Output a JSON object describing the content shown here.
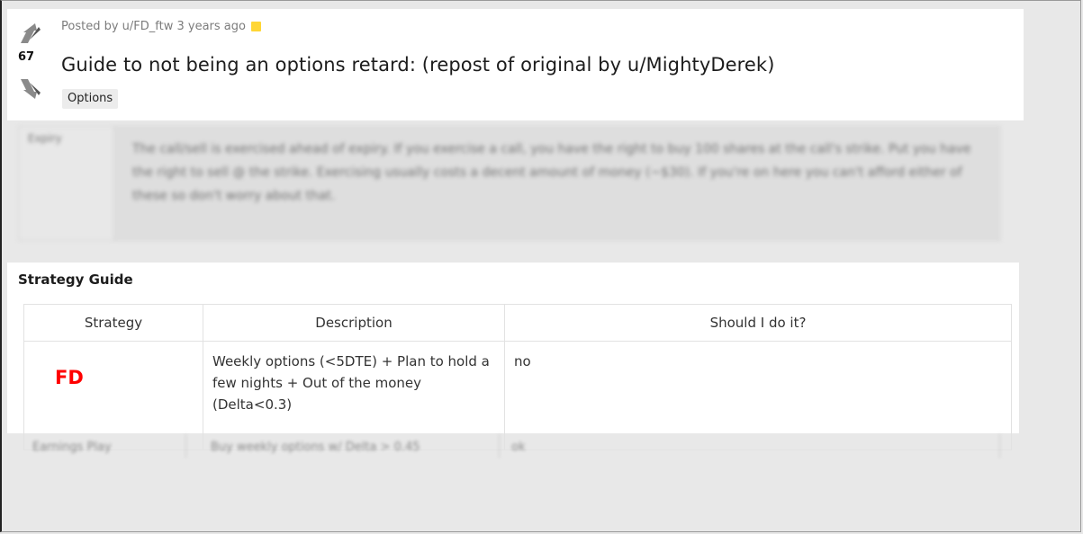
{
  "post": {
    "score": "67",
    "meta_text": "Posted by u/FD_ftw 3 years ago",
    "title": "Guide to not being an options retard: (repost of original by u/MightyDerek)",
    "flair": "Options"
  },
  "blurred_upper": {
    "left_label": "Expiry",
    "text": "The call/sell is exercised ahead of expiry. If you exercise a call, you have the right to buy 100 shares at the call's strike. Put you have the right to sell @ the strike. Exercising usually costs a decent amount of money (~$30). If you're on here you can't afford either of these so don't worry about that."
  },
  "strategy_guide": {
    "heading": "Strategy Guide",
    "columns": [
      "Strategy",
      "Description",
      "Should I do it?"
    ],
    "rows": [
      {
        "strategy": "FD",
        "description": "Weekly options (<5DTE) + Plan to hold a few nights + Out of the money (Delta<0.3)",
        "should": "no"
      }
    ],
    "blurred_row": {
      "strategy": "Earnings Play",
      "description": "Buy weekly options w/ Delta > 0.45",
      "should": "ok"
    }
  },
  "colors": {
    "background": "#e8e8e8",
    "card": "#ffffff",
    "fd_red": "#ff0000",
    "award": "#ffd635"
  }
}
